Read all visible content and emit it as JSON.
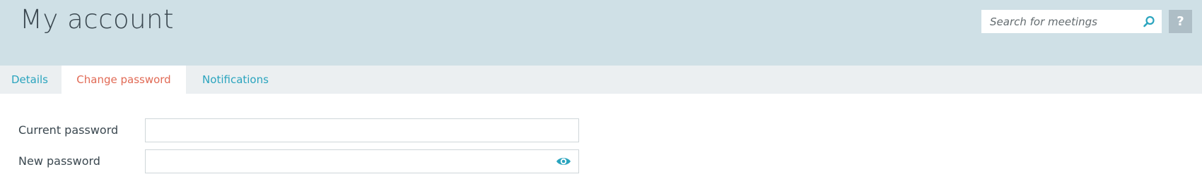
{
  "header": {
    "title": "My account",
    "search": {
      "placeholder": "Search for meetings",
      "value": ""
    },
    "help_label": "?"
  },
  "tabs": [
    {
      "label": "Details",
      "active": false
    },
    {
      "label": "Change password",
      "active": true
    },
    {
      "label": "Notifications",
      "active": false
    }
  ],
  "form": {
    "current_password": {
      "label": "Current password",
      "value": ""
    },
    "new_password": {
      "label": "New password",
      "value": ""
    }
  },
  "colors": {
    "header_bg": "#cfe0e6",
    "tabbar_bg": "#ebeff1",
    "accent_teal": "#2aa4be",
    "active_tab_text": "#e16a55",
    "help_button_bg": "#aebec6"
  },
  "icons": {
    "search": "search-icon",
    "eye": "eye-icon"
  }
}
